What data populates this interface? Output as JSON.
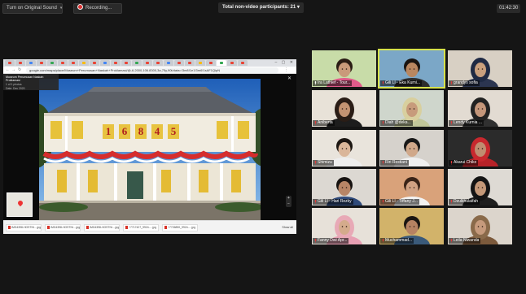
{
  "toolbar": {
    "sound_button": "Turn on Original Sound",
    "recording_label": "Recording...",
    "participants_label": "Total non-video participants: 21",
    "timer": "01:42:30"
  },
  "shared_screen": {
    "url": "google.com/maps/place/Museum+Perumusan+Naskah+Proklamasi/@-6.2000,106.8300,3a,75y,90t/data=!3m8!1e1!3m6!1sAF1QipN",
    "place_title": "Museum Perumusan Naskah Proklamasi",
    "place_sub": "1 of 1 photos",
    "place_date": "Date: Dec 2020",
    "building_number": [
      "1",
      "6",
      "8",
      "4",
      "5"
    ],
    "downloads": [
      "IMG4398-HOSTNI....jpg",
      "IMG4398-HOSTNI....jpg",
      "IMG4398-HOSTNI....jpg",
      "+7717427_9924-....jpg",
      "+7726890_9924-....jpg"
    ],
    "show_all": "Show all"
  },
  "participants": [
    {
      "name": "Ira Lathief - Tour...",
      "bg": "#c8dca8",
      "skin": "#c99a7a",
      "hair": "#2a1c14",
      "hijab": false,
      "shirt": "#e05a8a",
      "mic": "on"
    },
    {
      "name": "Gili LI - Eka Kurni...",
      "bg": "#7ba7c7",
      "skin": "#b98760",
      "hair": "#1a1410",
      "hijab": false,
      "shirt": "#2c2c2c",
      "mic": "muted",
      "active": true
    },
    {
      "name": "grandys sofia",
      "bg": "#d8d0c4",
      "skin": "#c9a07e",
      "hair": "#1f2a44",
      "hijab": true,
      "shirt": "#2b3550",
      "mic": "muted"
    },
    {
      "name": "Aniberta",
      "bg": "#e8e2d8",
      "skin": "#c49372",
      "hair": "#2a1d16",
      "hijab": true,
      "shirt": "#1d1d1d",
      "mic": "muted"
    },
    {
      "name": "Diah @deka...",
      "bg": "#cfd6cc",
      "skin": "#c79b7b",
      "hair": "#d8cf9e",
      "hijab": true,
      "shirt": "#c2c79a",
      "mic": "muted"
    },
    {
      "name": "Lendy Kurnia ...",
      "bg": "#e2dbd2",
      "skin": "#c4967a",
      "hair": "#222222",
      "hijab": true,
      "shirt": "#303030",
      "mic": "muted"
    },
    {
      "name": "Shimizu",
      "bg": "#e9e4dc",
      "skin": "#dab69a",
      "hair": "#1c1612",
      "hijab": false,
      "shirt": "#eeeeee",
      "mic": "muted"
    },
    {
      "name": "Riri Restiani",
      "bg": "#d6d2cc",
      "skin": "#d0a88a",
      "hair": "#181818",
      "hijab": false,
      "shirt": "#efefef",
      "mic": "muted"
    },
    {
      "name": "Akarui Chiko",
      "bg": "#2b2b2b",
      "skin": "#c08c70",
      "hair": "#c8282e",
      "hijab": true,
      "shirt": "#b82228",
      "mic": "muted"
    },
    {
      "name": "Gili LI - Hari Rezky",
      "bg": "#dcd8d2",
      "skin": "#b78566",
      "hair": "#161210",
      "hijab": false,
      "shirt": "#2f4a7a",
      "mic": "muted"
    },
    {
      "name": "Gili LI - Tiffany J...",
      "bg": "#d9a27a",
      "skin": "#d1a283",
      "hair": "#3a2418",
      "hijab": false,
      "shirt": "#f2f2f2",
      "mic": "muted"
    },
    {
      "name": "Dzulkhulaifah",
      "bg": "#dedad4",
      "skin": "#c49878",
      "hair": "#141414",
      "hijab": true,
      "shirt": "#1e1e1e",
      "mic": "muted"
    },
    {
      "name": "Fanny Dwi Apr...",
      "bg": "#e7e1d9",
      "skin": "#d4ab8c",
      "hair": "#e8a9b6",
      "hijab": true,
      "shirt": "#e79fb3",
      "mic": "muted"
    },
    {
      "name": "Muchammad...",
      "bg": "#d2b36a",
      "skin": "#b68262",
      "hair": "#1a1512",
      "hijab": false,
      "shirt": "#3a5a7a",
      "mic": "muted"
    },
    {
      "name": "Leila Niwanda",
      "bg": "#dcd5cc",
      "skin": "#c69a7c",
      "hair": "#8a6a4a",
      "hijab": true,
      "shirt": "#7c5a3c",
      "mic": "muted"
    }
  ]
}
